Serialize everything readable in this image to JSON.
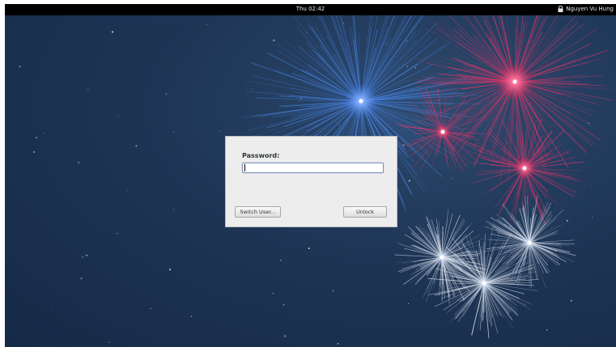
{
  "topbar": {
    "clock": "Thu 02:42",
    "user_name": "Nguyen Vu Hung",
    "lock_icon": "lock-icon"
  },
  "dialog": {
    "password_label": "Password:",
    "password_value": "",
    "switch_user_label": "Switch User...",
    "unlock_label": "Unlock"
  },
  "colors": {
    "background": "#1e3556",
    "topbar": "#000000",
    "dialog": "#ededed",
    "firework_blue": "#4a86e8",
    "firework_pink": "#e0356a",
    "firework_white": "#e8eef8"
  }
}
